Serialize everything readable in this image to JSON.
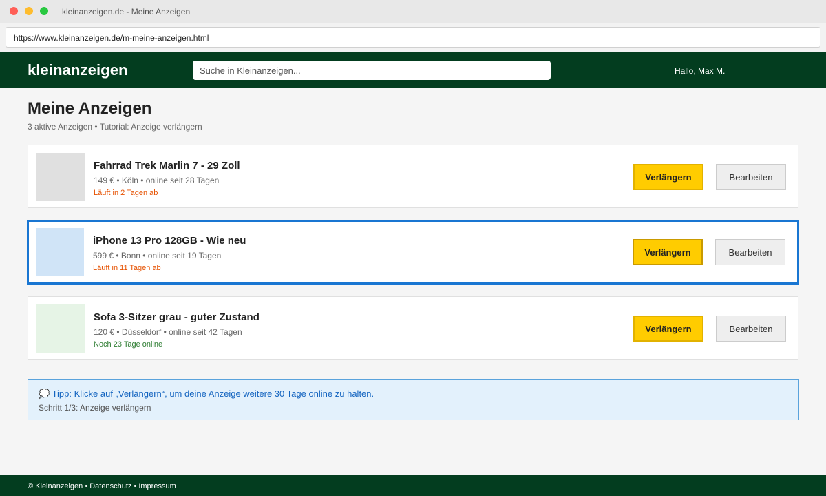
{
  "browser": {
    "window_title": "kleinanzeigen.de - Meine Anzeigen",
    "url": "https://www.kleinanzeigen.de/m-meine-anzeigen.html"
  },
  "header": {
    "logo": "kleinanzeigen",
    "search_placeholder": "Suche in Kleinanzeigen...",
    "greeting": "Hallo, Max M."
  },
  "page": {
    "title": "Meine Anzeigen",
    "subtitle": "3 aktive Anzeigen • Tutorial: Anzeige verlängern"
  },
  "listings": [
    {
      "title": "Fahrrad Trek Marlin 7 - 29 Zoll",
      "meta": "149 € • Köln • online seit 28 Tagen",
      "status": "Läuft in 2 Tagen ab",
      "status_color": "#e65100",
      "thumb_color": "#e0e0e0",
      "renew_label": "Verlängern",
      "edit_label": "Bearbeiten"
    },
    {
      "title": "iPhone 13 Pro 128GB - Wie neu",
      "meta": "599 € • Bonn • online seit 19 Tagen",
      "status": "Läuft in 11 Tagen ab",
      "status_color": "#e65100",
      "thumb_color": "#d0e4f7",
      "renew_label": "Verlängern",
      "edit_label": "Bearbeiten"
    },
    {
      "title": "Sofa 3-Sitzer grau - guter Zustand",
      "meta": "120 € • Düsseldorf • online seit 42 Tagen",
      "status": "Noch 23 Tage online",
      "status_color": "#2e7d32",
      "thumb_color": "#e6f4e6",
      "renew_label": "Verlängern",
      "edit_label": "Bearbeiten"
    }
  ],
  "tip": {
    "text": "💭 Tipp: Klicke auf „Verlängern“, um deine Anzeige weitere 30 Tage online zu halten.",
    "step": "Schritt 1/3: Anzeige verlängern"
  },
  "footer": {
    "text": "© Kleinanzeigen • Datenschutz • Impressum"
  },
  "colors": {
    "brand_green": "#033d1f",
    "renew_yellow": "#ffcc00",
    "highlight_blue": "#1976d2"
  }
}
